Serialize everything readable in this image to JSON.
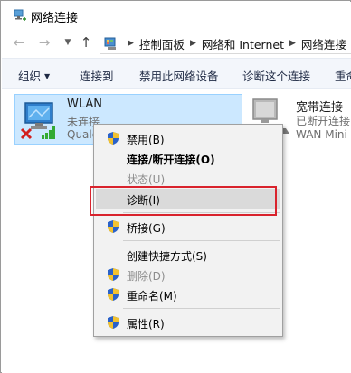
{
  "window": {
    "title": "网络连接"
  },
  "address": {
    "crumbs": [
      "控制面板",
      "网络和 Internet",
      "网络连接"
    ]
  },
  "toolbar": {
    "organize": "组织",
    "connect_to": "连接到",
    "disable_device": "禁用此网络设备",
    "diagnose": "诊断这个连接",
    "rename_partial": "重命"
  },
  "connections": [
    {
      "name": "WLAN",
      "status": "未连接",
      "device": "Qualco",
      "selected": true
    },
    {
      "name": "宽带连接",
      "status": "已断开连接",
      "device": "WAN Mini",
      "selected": false
    }
  ],
  "context_menu": {
    "items": [
      {
        "label": "禁用(B)",
        "shield": true,
        "bold": false,
        "disabled": false
      },
      {
        "label": "连接/断开连接(O)",
        "shield": false,
        "bold": true,
        "disabled": false
      },
      {
        "label": "状态(U)",
        "shield": false,
        "bold": false,
        "disabled": true
      },
      {
        "label": "诊断(I)",
        "shield": false,
        "bold": false,
        "disabled": false,
        "highlighted": true
      },
      {
        "label": "桥接(G)",
        "shield": true,
        "bold": false,
        "disabled": false
      },
      {
        "label": "创建快捷方式(S)",
        "shield": false,
        "bold": false,
        "disabled": false
      },
      {
        "label": "删除(D)",
        "shield": true,
        "bold": false,
        "disabled": true
      },
      {
        "label": "重命名(M)",
        "shield": true,
        "bold": false,
        "disabled": false
      },
      {
        "label": "属性(R)",
        "shield": true,
        "bold": false,
        "disabled": false
      }
    ]
  },
  "colors": {
    "selection_bg": "#cce8ff",
    "highlight_box": "#d9232d",
    "menu_bg": "#f2f2f2"
  }
}
